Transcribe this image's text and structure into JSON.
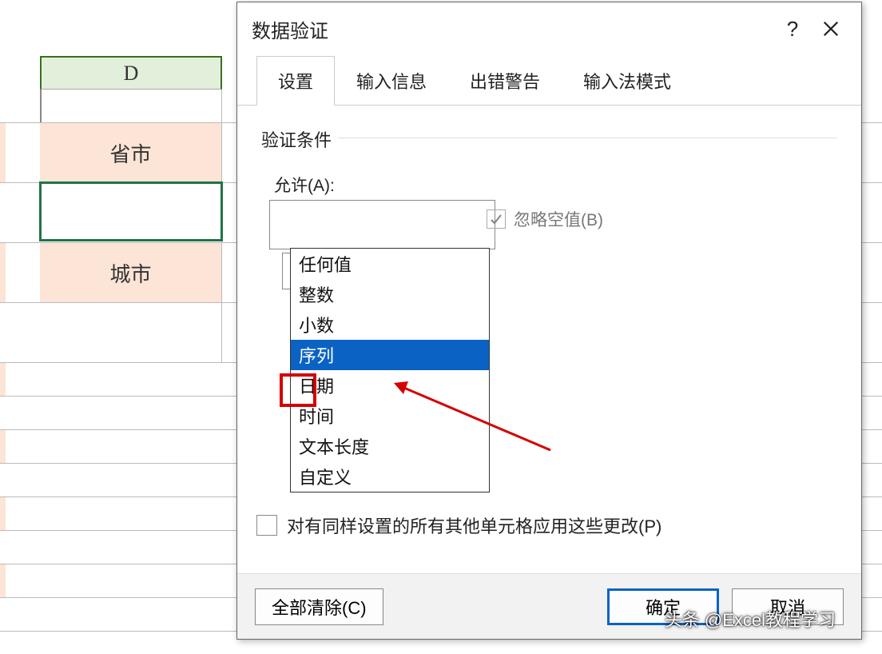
{
  "sheet": {
    "column_header": "D",
    "rows": {
      "label1": "省市",
      "label2": "城市"
    }
  },
  "dialog": {
    "title": "数据验证",
    "help": "?",
    "tabs": [
      "设置",
      "输入信息",
      "出错警告",
      "输入法模式"
    ],
    "active_tab": 0,
    "group_label": "验证条件",
    "allow_label": "允许(A):",
    "allow_value": "任何值",
    "allow_options": [
      "任何值",
      "整数",
      "小数",
      "序列",
      "日期",
      "时间",
      "文本长度",
      "自定义"
    ],
    "allow_selected_index": 3,
    "ignore_blank_label": "忽略空值(B)",
    "ignore_blank_checked": true,
    "apply_others_label": "对有同样设置的所有其他单元格应用这些更改(P)",
    "apply_others_checked": false,
    "buttons": {
      "clear_all": "全部清除(C)",
      "ok": "确定",
      "cancel": "取消"
    }
  },
  "watermark": "头条 @Excel教程学习"
}
